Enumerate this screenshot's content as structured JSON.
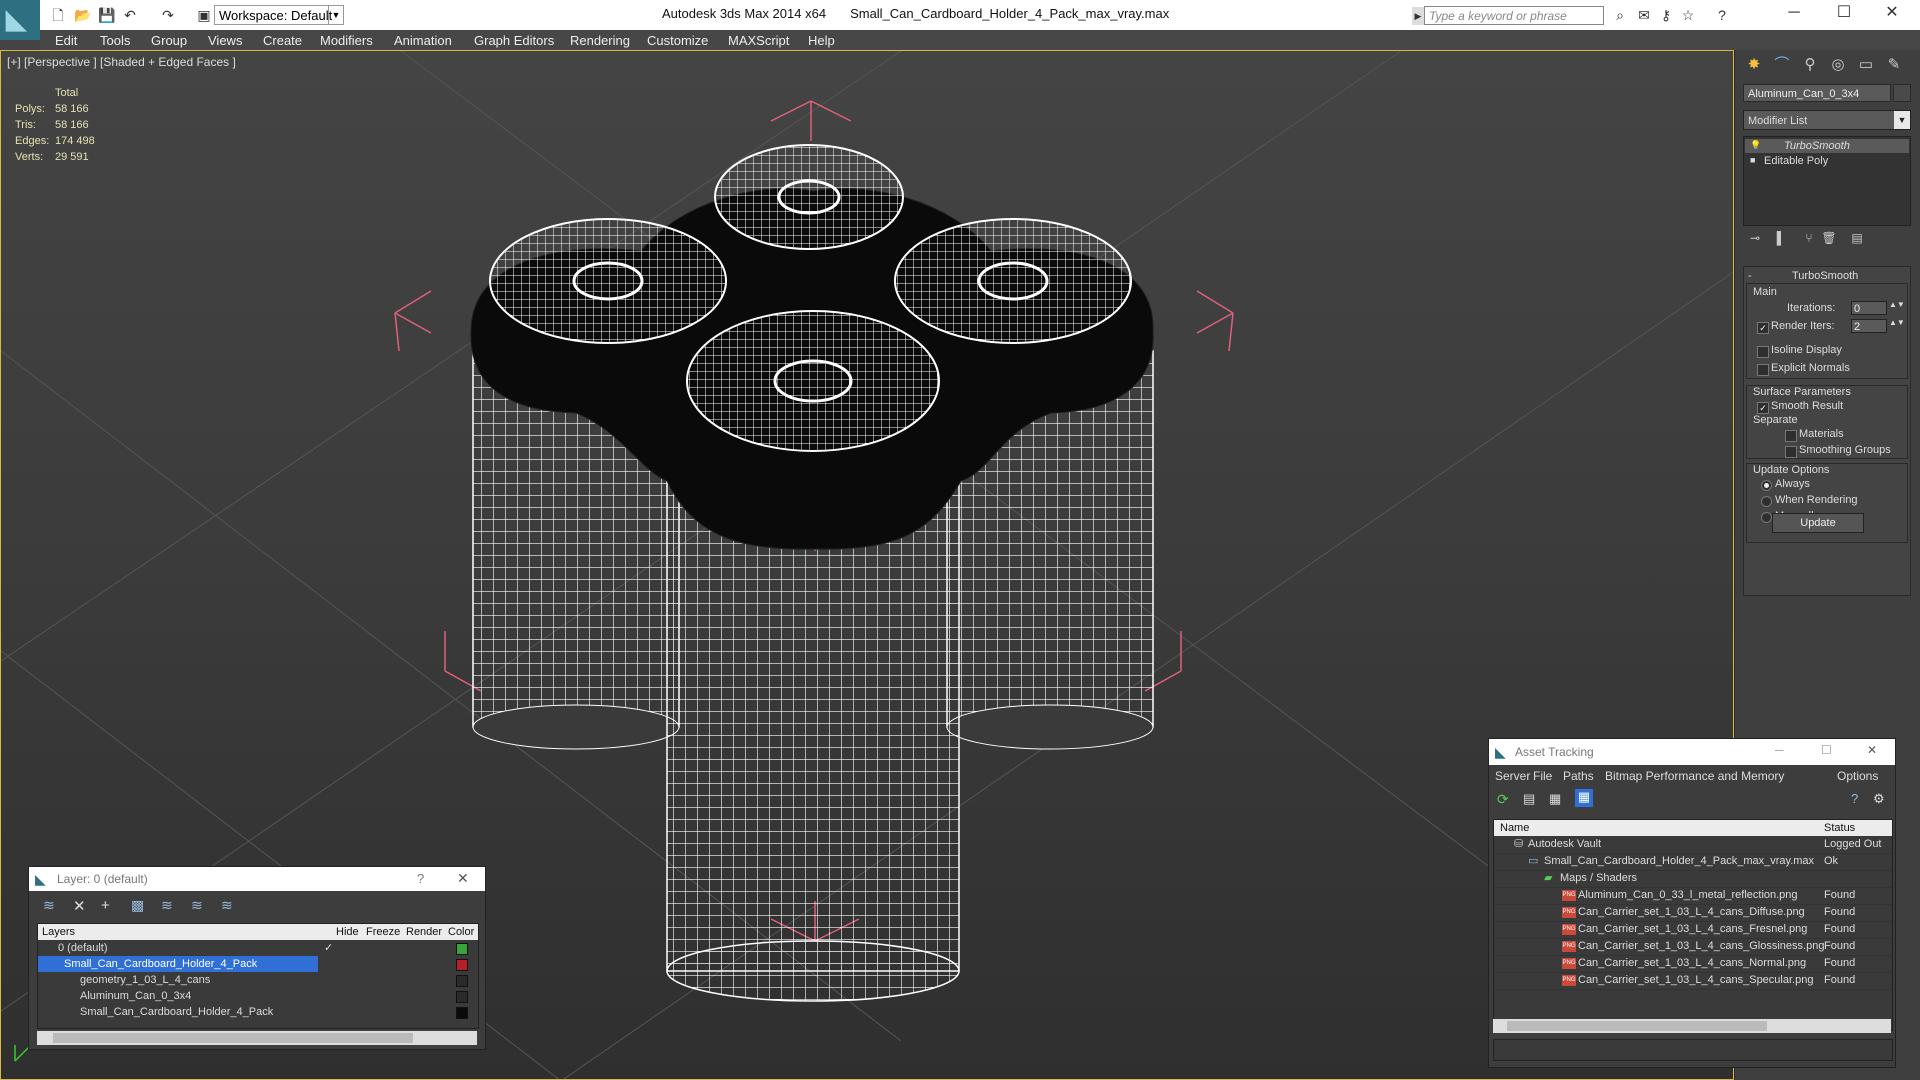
{
  "window": {
    "app_title": "Autodesk 3ds Max  2014 x64",
    "file_title": "Small_Can_Cardboard_Holder_4_Pack_max_vray.max",
    "workspace": "Workspace: Default",
    "search_placeholder": "Type a keyword or phrase"
  },
  "menu": [
    "Edit",
    "Tools",
    "Group",
    "Views",
    "Create",
    "Modifiers",
    "Animation",
    "Graph Editors",
    "Rendering",
    "Customize",
    "MAXScript",
    "Help"
  ],
  "viewport": {
    "label": "[+] [Perspective ] [Shaded + Edged Faces ]",
    "stats_header": "Total",
    "stats": [
      {
        "key": "Polys:",
        "value": "58 166"
      },
      {
        "key": "Tris:",
        "value": "58 166"
      },
      {
        "key": "Edges:",
        "value": "174 498"
      },
      {
        "key": "Verts:",
        "value": "29 591"
      }
    ]
  },
  "command_panel": {
    "object_name": "Aluminum_Can_0_3x4",
    "modifier_list": "Modifier List",
    "stack": [
      "TurboSmooth",
      "Editable Poly"
    ],
    "rollout_title": "TurboSmooth",
    "main_label": "Main",
    "iterations_label": "Iterations:",
    "iterations_value": "0",
    "render_iters_label": "Render Iters:",
    "render_iters_value": "2",
    "isoline": "Isoline Display",
    "explicit_normals": "Explicit Normals",
    "surface_params": "Surface Parameters",
    "smooth_result": "Smooth Result",
    "separate": "Separate",
    "materials": "Materials",
    "smoothing_groups": "Smoothing Groups",
    "update_options": "Update Options",
    "always": "Always",
    "when_rendering": "When Rendering",
    "manually": "Manually",
    "update_button": "Update"
  },
  "layer_window": {
    "title": "Layer: 0 (default)",
    "columns": [
      "Layers",
      "Hide",
      "Freeze",
      "Render",
      "Color"
    ],
    "rows": [
      {
        "name": "0 (default)",
        "color": "#39a33b"
      },
      {
        "name": "Small_Can_Cardboard_Holder_4_Pack",
        "color": "#b3202a"
      },
      {
        "name": "geometry_1_03_L_4_cans",
        "color": "#2a2a2a"
      },
      {
        "name": "Aluminum_Can_0_3x4",
        "color": "#2a2a2a"
      },
      {
        "name": "Small_Can_Cardboard_Holder_4_Pack",
        "color": "#0a0a0a"
      }
    ]
  },
  "asset_window": {
    "title": "Asset Tracking",
    "menu": [
      "Server",
      "File",
      "Paths",
      "Bitmap Performance and Memory",
      "Options"
    ],
    "columns": [
      "Name",
      "Status"
    ],
    "rows": [
      {
        "name": "Autodesk Vault",
        "status": "Logged Out"
      },
      {
        "name": "Small_Can_Cardboard_Holder_4_Pack_max_vray.max",
        "status": "Ok"
      },
      {
        "name": "Maps / Shaders",
        "status": ""
      },
      {
        "name": "Aluminum_Can_0_33_l_metal_reflection.png",
        "status": "Found"
      },
      {
        "name": "Can_Carrier_set_1_03_L_4_cans_Diffuse.png",
        "status": "Found"
      },
      {
        "name": "Can_Carrier_set_1_03_L_4_cans_Fresnel.png",
        "status": "Found"
      },
      {
        "name": "Can_Carrier_set_1_03_L_4_cans_Glossiness.png",
        "status": "Found"
      },
      {
        "name": "Can_Carrier_set_1_03_L_4_cans_Normal.png",
        "status": "Found"
      },
      {
        "name": "Can_Carrier_set_1_03_L_4_cans_Specular.png",
        "status": "Found"
      }
    ]
  },
  "colors": {
    "viewport_border": "#d9b940",
    "bbox": "#e0607a",
    "selection": "#2f6fd6"
  }
}
